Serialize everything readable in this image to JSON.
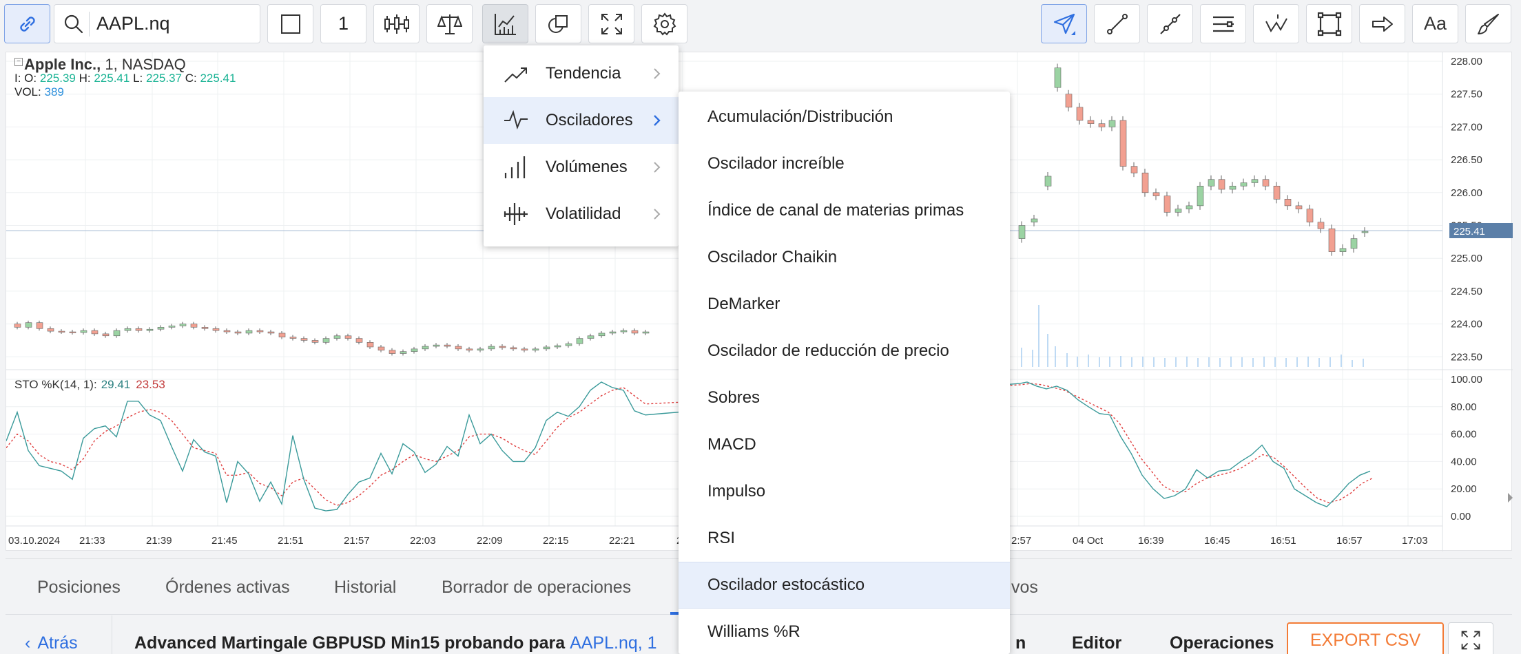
{
  "toolbar": {
    "symbol": "AAPL.nq",
    "interval": "1",
    "font_label": "Aa"
  },
  "chart": {
    "instrument_name": "Apple Inc.,",
    "interval": "1,",
    "exchange": "NASDAQ",
    "ohlc": {
      "o_label": "I: O:",
      "o": "225.39",
      "h_label": "H:",
      "h": "225.41",
      "l_label": "L:",
      "l": "225.37",
      "c_label": "C:",
      "c": "225.41"
    },
    "volume_label": "VOL:",
    "volume": "389",
    "last_price_tag": "225.41",
    "price_axis": [
      "228.00",
      "227.50",
      "227.00",
      "226.50",
      "226.00",
      "225.50",
      "225.00",
      "224.50",
      "224.00",
      "223.50"
    ],
    "indicator_axis": [
      "100.00",
      "80.00",
      "60.00",
      "40.00",
      "20.00",
      "0.00"
    ],
    "time_axis": [
      "03.10.2024",
      "21:33",
      "21:39",
      "21:45",
      "21:51",
      "21:57",
      "22:03",
      "22:09",
      "22:15",
      "22:21",
      "2",
      "2:57",
      "04 Oct",
      "16:39",
      "16:45",
      "16:51",
      "16:57",
      "17:03"
    ],
    "indicator_legend": {
      "name": "STO %K(14, 1):",
      "k": "29.41",
      "d": "23.53"
    },
    "colors": {
      "up": "#9bd3a3",
      "down": "#f2a091",
      "k_line": "#3a9a9a",
      "d_line": "#e04040",
      "volume": "#a8cdf0",
      "last_price": "#5b7fa8"
    }
  },
  "menu_categories": {
    "items": [
      {
        "label": "Tendencia",
        "icon": "trend-icon"
      },
      {
        "label": "Osciladores",
        "icon": "oscillator-icon"
      },
      {
        "label": "Volúmenes",
        "icon": "volume-bars-icon"
      },
      {
        "label": "Volatilidad",
        "icon": "volatility-icon"
      }
    ]
  },
  "menu_oscillators": {
    "items": [
      "Acumulación/Distribución",
      "Oscilador increíble",
      "Índice de canal de materias primas",
      "Oscilador Chaikin",
      "DeMarker",
      "Oscilador de reducción de precio",
      "Sobres",
      "MACD",
      "Impulso",
      "RSI",
      "Oscilador estocástico",
      "Williams %R"
    ]
  },
  "bottom": {
    "tabs": [
      "Posiciones",
      "Órdenes activas",
      "Historial",
      "Borrador de operaciones",
      "vos"
    ],
    "back_label": "Atrás",
    "strategy_text": "Advanced Martingale GBPUSD Min15 probando para",
    "strategy_symbol": "AAPL.nq, 1",
    "right_tabs": [
      "n",
      "Editor",
      "Operaciones"
    ],
    "export_label": "EXPORT CSV"
  }
}
